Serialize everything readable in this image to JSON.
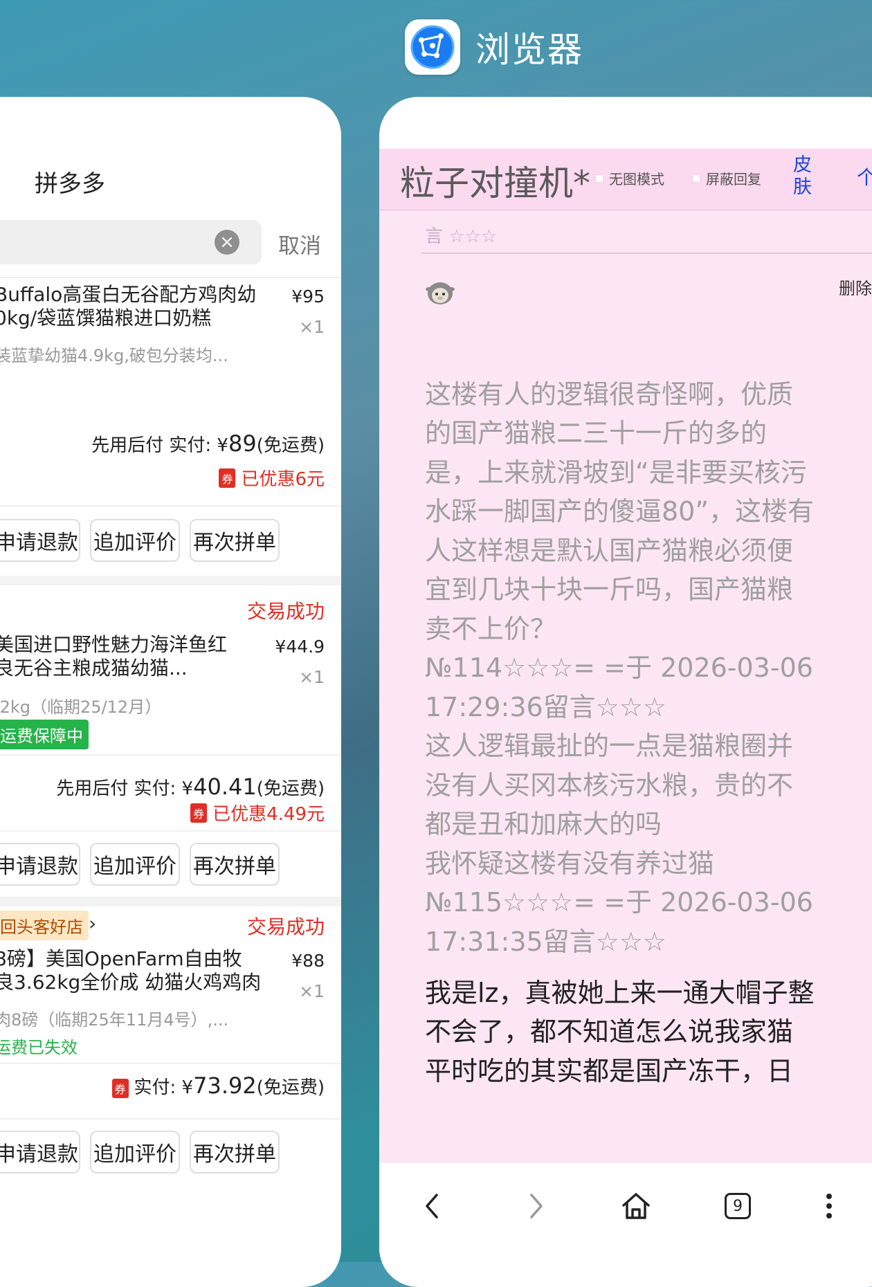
{
  "top_app": {
    "title": "浏览器",
    "icon": "browser-compass-icon",
    "accent": "#1a7cf0"
  },
  "left_app": {
    "title": "拼多多",
    "search": {
      "clear_icon": "close-circle-icon",
      "cancel_label": "取消"
    },
    "orders": [
      {
        "name_line1": "Buffalo高蛋白无谷配方鸡肉幼",
        "name_line2": "0kg/袋蓝馔猫粮进口奶糕",
        "sub": "装蓝挚幼猫4.9kg,破包分装均...",
        "price": "¥95",
        "qty": "×1",
        "paid_prefix": "先用后付 实付: ¥",
        "paid_amount": "89",
        "paid_suffix": "(免运费)",
        "coupon_label": "券",
        "discount": "已优惠6元",
        "buttons": [
          "申请退款",
          "追加评价",
          "再次拼单"
        ]
      },
      {
        "status": "交易成功",
        "name_line1": "美国进口野性魅力海洋鱼红",
        "name_line2": "良无谷主粮成猫幼猫...",
        "sub": ".2kg（临期25/12月）",
        "price": "¥44.9",
        "qty": "×1",
        "tag": "运费保障中",
        "paid_prefix": "先用后付 实付: ¥",
        "paid_amount": "40.41",
        "paid_suffix": "(免运费)",
        "coupon_label": "券",
        "discount": "已优惠4.49元",
        "buttons": [
          "申请退款",
          "追加评价",
          "再次拼单"
        ]
      },
      {
        "shop_tag": "回头客好店",
        "status": "交易成功",
        "name_line1": "8磅】美国OpenFarm自由牧",
        "name_line2": "良3.62kg全价成 幼猫火鸡鸡肉",
        "sub": "肉8磅（临期25年11月4号）,...",
        "price": "¥88",
        "qty": "×1",
        "tag": "运费已失效",
        "paid_prefix": "实付: ¥",
        "paid_amount": "73.92",
        "paid_suffix": "(免运费)",
        "coupon_label": "券",
        "buttons": [
          "申请退款",
          "追加评价",
          "再次拼单"
        ]
      }
    ]
  },
  "browser": {
    "site_title": "粒子对撞机*",
    "options": [
      "无图模式",
      "屏蔽回复"
    ],
    "skin_link": "皮肤",
    "prev_stars": "言 ☆☆☆",
    "delete_link": "删除",
    "post_lines": [
      "这楼有人的逻辑很奇怪啊，优质",
      "的国产猫粮二三十一斤的多的",
      "是，上来就滑坡到“是非要买核污",
      "水踩一脚国产的傻逼80”，这楼有",
      "人这样想是默认国产猫粮必须便",
      "宜到几块十块一斤吗，国产猫粮",
      "卖不上价？",
      "№114☆☆☆= =于 2026-03-06",
      "17:29:36留言☆☆☆",
      "这人逻辑最扯的一点是猫粮圈并",
      "没有人买冈本核污水粮，贵的不",
      "都是丑和加麻大的吗",
      "我怀疑这楼有没有养过猫",
      "№115☆☆☆= =于 2026-03-06",
      "17:31:35留言☆☆☆"
    ],
    "post_dark_lines": [
      "我是lz，真被她上来一通大帽子整",
      "不会了，都不知道怎么说我家猫",
      "平时吃的其实都是国产冻干，日"
    ],
    "nav": {
      "tab_count": "9"
    }
  }
}
